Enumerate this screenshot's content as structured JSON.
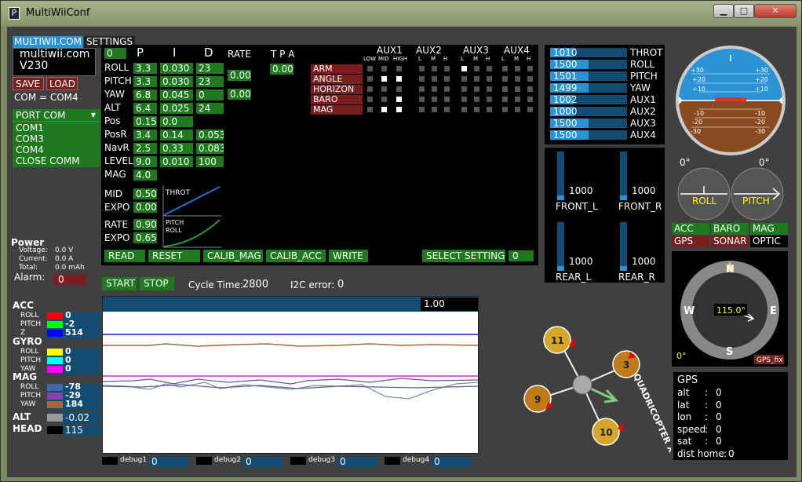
{
  "window": {
    "title": "MultiWiiConf",
    "app_icon": "P"
  },
  "brand": {
    "tab1": "MULTIWII.COM",
    "tab2": "SETTINGS",
    "site": "multiwii.com",
    "version": "V230"
  },
  "left": {
    "save": "SAVE",
    "load": "LOAD",
    "com_status": "COM = COM4",
    "port_com": "PORT COM",
    "ports": [
      "COM1",
      "COM3",
      "COM4",
      "CLOSE COMM"
    ],
    "power_title": "Power",
    "voltage_label": "Voltage:",
    "voltage_value": "0.0 V",
    "current_label": "Current:",
    "current_value": "0.0 A",
    "total_label": "Total:",
    "total_value": "0.0 mAh",
    "alarm_label": "Alarm:",
    "alarm_value": "0"
  },
  "pid": {
    "setting_value": "0",
    "head_p": "P",
    "head_i": "I",
    "head_d": "D",
    "head_rate": "RATE",
    "head_tpa": "T P A",
    "rows": [
      {
        "name": "ROLL",
        "p": "3.3",
        "i": "0.030",
        "d": "23"
      },
      {
        "name": "PITCH",
        "p": "3.3",
        "i": "0.030",
        "d": "23"
      },
      {
        "name": "YAW",
        "p": "6.8",
        "i": "0.045",
        "d": "0"
      },
      {
        "name": "ALT",
        "p": "6.4",
        "i": "0.025",
        "d": "24"
      },
      {
        "name": "Pos",
        "p": "0.15",
        "i": "0.0",
        "d": ""
      },
      {
        "name": "PosR",
        "p": "3.4",
        "i": "0.14",
        "d": "0.053"
      },
      {
        "name": "NavR",
        "p": "2.5",
        "i": "0.33",
        "d": "0.083"
      },
      {
        "name": "LEVEL",
        "p": "9.0",
        "i": "0.010",
        "d": "100"
      },
      {
        "name": "MAG",
        "p": "4.0",
        "i": "",
        "d": ""
      }
    ],
    "rate_roll_pitch": "0.00",
    "rate_yaw": "0.00",
    "tpa": "0.00",
    "mid_label": "MID",
    "mid_value": "0.50",
    "expo_label": "EXPO",
    "expo_value": "0.00",
    "throt_curve_label": "THROT",
    "rate_label": "RATE",
    "rate_value": "0.90",
    "expo2_label": "EXPO",
    "expo2_value": "0.65",
    "pitchroll_curve_label1": "PITCH",
    "pitchroll_curve_label2": "ROLL",
    "buttons": {
      "read": "READ",
      "reset": "RESET",
      "calib_mag": "CALIB_MAG",
      "calib_acc": "CALIB_ACC",
      "write": "WRITE",
      "select_setting": "SELECT SETTING",
      "select_value": "0"
    }
  },
  "aux": {
    "headers": [
      "AUX1",
      "AUX2",
      "AUX3",
      "AUX4"
    ],
    "sub_aux1": [
      "LOW",
      "MID",
      "HIGH"
    ],
    "sub_other": [
      "L",
      "M",
      "H"
    ],
    "modes": [
      {
        "name": "ARM",
        "on": [
          6
        ]
      },
      {
        "name": "ANGLE",
        "on": [
          1,
          2
        ]
      },
      {
        "name": "HORIZON",
        "on": []
      },
      {
        "name": "BARO",
        "on": [
          2
        ]
      },
      {
        "name": "MAG",
        "on": [
          1,
          2
        ]
      }
    ]
  },
  "rc": {
    "channels": [
      {
        "name": "THROT",
        "value": "1010",
        "fraction": 0.01
      },
      {
        "name": "ROLL",
        "value": "1500",
        "fraction": 0.5
      },
      {
        "name": "PITCH",
        "value": "1501",
        "fraction": 0.5
      },
      {
        "name": "YAW",
        "value": "1499",
        "fraction": 0.5
      },
      {
        "name": "AUX1",
        "value": "1002",
        "fraction": 0.0
      },
      {
        "name": "AUX2",
        "value": "1000",
        "fraction": 0.0
      },
      {
        "name": "AUX3",
        "value": "1500",
        "fraction": 0.5
      },
      {
        "name": "AUX4",
        "value": "1500",
        "fraction": 0.5
      }
    ]
  },
  "motors": [
    {
      "name": "FRONT_L",
      "value": "1000"
    },
    {
      "name": "FRONT_R",
      "value": "1000"
    },
    {
      "name": "REAR_L",
      "value": "1000"
    },
    {
      "name": "REAR_R",
      "value": "1000"
    }
  ],
  "attitude": {
    "roll_angle": "0°",
    "pitch_angle": "0°",
    "roll_label": "ROLL",
    "pitch_label": "PITCH",
    "scale": [
      "+30",
      "+20",
      "+10",
      "-10",
      "-20",
      "-30"
    ]
  },
  "sensors": [
    {
      "name": "ACC",
      "active": true
    },
    {
      "name": "BARO",
      "active": true
    },
    {
      "name": "MAG",
      "active": true
    },
    {
      "name": "GPS",
      "active": false
    },
    {
      "name": "SONAR",
      "active": false
    },
    {
      "name": "OPTIC",
      "active": null
    }
  ],
  "compass": {
    "n": "N",
    "s": "S",
    "e": "E",
    "w": "W",
    "heading": "115.0°",
    "angle": "0°",
    "gps_fix": "GPS_fix"
  },
  "gps": {
    "title": "GPS",
    "rows": [
      {
        "label": "alt",
        "value": "0"
      },
      {
        "label": "lat",
        "value": "0"
      },
      {
        "label": "lon",
        "value": "0"
      },
      {
        "label": "speed",
        "value": "0"
      },
      {
        "label": "sat",
        "value": "0"
      },
      {
        "label": "dist home",
        "value": "0"
      }
    ]
  },
  "control": {
    "start": "START",
    "stop": "STOP",
    "cycle_label": "Cycle Time:",
    "cycle_value": "2800",
    "i2c_label": "I2C error:",
    "i2c_value": "0"
  },
  "graph": {
    "scale_value": "1.00"
  },
  "sensor_panel": {
    "acc_title": "ACC",
    "gyro_title": "GYRO",
    "mag_title": "MAG",
    "alt_title": "ALT",
    "head_title": "HEAD",
    "acc": [
      {
        "axis": "ROLL",
        "value": "0",
        "color": "#ff0000"
      },
      {
        "axis": "PITCH",
        "value": "-2",
        "color": "#00ff00"
      },
      {
        "axis": "Z",
        "value": "514",
        "color": "#0000ff"
      }
    ],
    "gyro": [
      {
        "axis": "ROLL",
        "value": "0",
        "color": "#ffff00"
      },
      {
        "axis": "PITCH",
        "value": "0",
        "color": "#00ffff"
      },
      {
        "axis": "YAW",
        "value": "0",
        "color": "#ff00ff"
      }
    ],
    "mag": [
      {
        "axis": "ROLL",
        "value": "-78",
        "color": "#4466aa"
      },
      {
        "axis": "PITCH",
        "value": "-29",
        "color": "#8844aa"
      },
      {
        "axis": "YAW",
        "value": "184",
        "color": "#aa6633"
      }
    ],
    "alt_value": "-0.02",
    "head_value": "115"
  },
  "debug": [
    {
      "label": "debug1",
      "value": "0"
    },
    {
      "label": "debug2",
      "value": "0"
    },
    {
      "label": "debug3",
      "value": "0"
    },
    {
      "label": "debug4",
      "value": "0"
    }
  ],
  "quad": {
    "label": "QUADRICOPTER X",
    "motors": [
      "11",
      "3",
      "9",
      "10"
    ]
  }
}
